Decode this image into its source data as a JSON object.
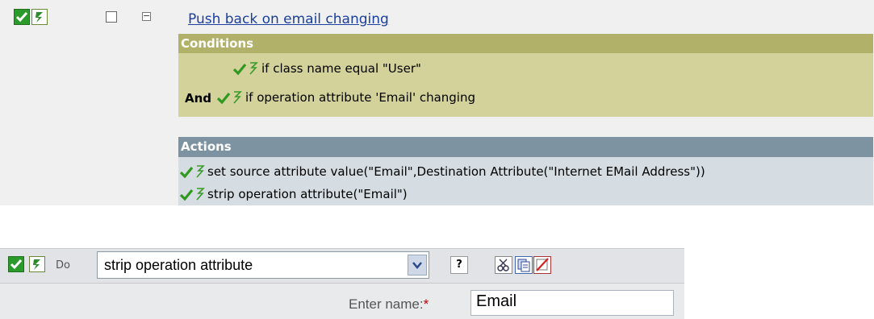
{
  "rule": {
    "title": "Push back on email changing",
    "conditions_header": "Conditions",
    "conditions": [
      {
        "prefix": "",
        "text": "if class name equal \"User\""
      },
      {
        "prefix": "And",
        "text": "if operation attribute 'Email' changing"
      }
    ],
    "actions_header": "Actions",
    "actions": [
      {
        "text": "set source attribute value(\"Email\",Destination Attribute(\"Internet EMail Address\"))"
      },
      {
        "text": "strip operation attribute(\"Email\")"
      }
    ]
  },
  "editor": {
    "do_label": "Do",
    "action_value": "strip operation attribute",
    "help_label": "?",
    "field_label": "Enter name:",
    "required_mark": "*",
    "field_value": "Email"
  },
  "colors": {
    "conditions_header": "#b1b16a",
    "conditions_bg": "#d2d29a",
    "actions_header": "#7d93a2",
    "actions_bg": "#d6dde2",
    "link": "#1a3f9e",
    "check_green": "#2a9a2a"
  }
}
